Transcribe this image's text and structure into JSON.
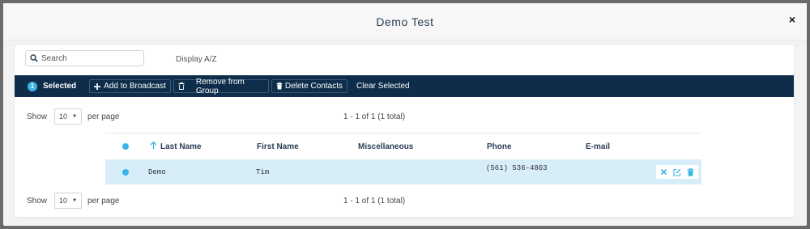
{
  "modal": {
    "title": "Demo Test",
    "close_symbol": "×"
  },
  "search": {
    "placeholder": "Search",
    "value": ""
  },
  "display_toggle": "Display A/Z",
  "toolbar": {
    "selected_count": "1",
    "selected_label": "Selected",
    "add_to_broadcast": "Add to Broadcast",
    "remove_from_group": "Remove from Group",
    "delete_contacts": "Delete Contacts",
    "clear_selected": "Clear Selected"
  },
  "pager_top": {
    "show_label": "Show",
    "page_size": "10",
    "per_page_label": "per page",
    "range": "1 - 1 of 1 (1 total)"
  },
  "pager_bottom": {
    "show_label": "Show",
    "page_size": "10",
    "per_page_label": "per page",
    "range": "1 - 1 of 1 (1 total)"
  },
  "table": {
    "columns": [
      "Last Name",
      "First Name",
      "Miscellaneous",
      "Phone",
      "E-mail"
    ],
    "sort_column": "Last Name",
    "rows": [
      {
        "last_name": "Demo",
        "first_name": "Tim",
        "miscellaneous": "",
        "phone": "(561) 536-4803",
        "email": "",
        "selected": true
      }
    ]
  },
  "icons": {
    "search": "search-icon",
    "plus": "plus-icon",
    "trash": "trash-icon",
    "sort": "arrow-up-icon",
    "remove": "x-icon",
    "edit": "edit-icon",
    "delete": "trash-icon"
  },
  "colors": {
    "toolbar_bg": "#0e2d4a",
    "accent": "#3bb3e8",
    "row_selected": "#d7eef9",
    "title": "#2b3e57"
  }
}
